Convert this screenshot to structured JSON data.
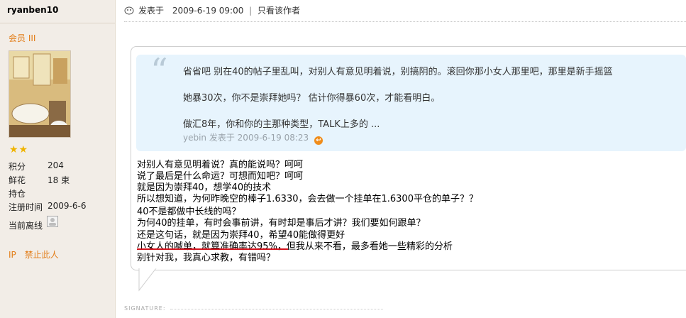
{
  "user": {
    "name": "ryanben10",
    "rank": "会员 III",
    "stats": [
      {
        "label": "积分",
        "value": "204"
      },
      {
        "label": "鲜花",
        "value": "18 束"
      },
      {
        "label": "持仓",
        "value": ""
      },
      {
        "label": "注册时间",
        "value": "2009-6-6"
      }
    ],
    "online_label": "当前离线",
    "stars": "★★",
    "actions": [
      "IP",
      "禁止此人"
    ]
  },
  "post": {
    "posted_label": "发表于",
    "posted_time": "2009-6-19 09:00",
    "separator": "|",
    "author_only": "只看该作者"
  },
  "quote": {
    "lines": [
      "省省吧  别在40的帖子里乱叫，对别人有意见明着说，别搞阴的。滚回你那小女人那里吧，那里是新手摇篮",
      "她暴30次，你不是崇拜她吗？  估计你得暴60次，才能看明白。",
      "做汇8年，你和你的主那种类型，TALK上多的   ..."
    ],
    "meta": "yebin 发表于  2009-6-19 08:23"
  },
  "body": {
    "lines": [
      "对别人有意见明着说？真的能说吗？呵呵",
      "说了最后是什么命运？可想而知吧？呵呵",
      "就是因为崇拜40，想学40的技术",
      "所以想知道，为何昨晚空的棒子1.6330，会去做一个挂单在1.6300平仓的单子？？",
      "40不是都做中长线的吗？",
      "为何40的挂单，有时会事前讲，有时却是事后才讲？我们要如何跟单？",
      "还是这句话，就是因为崇拜40，希望40能做得更好",
      "小女人的喊单，就算准确率达95%，但我从来不看，最多看她一些精彩的分析",
      "别针对我，我真心求教，有错吗？"
    ]
  },
  "signature": "SIGNATURE:",
  "colors": {
    "accent_orange": "#e27d18",
    "quote_bg": "#e7f4fd",
    "sidebar_bg": "#f2ede7",
    "underline_red": "#d3121c"
  },
  "icons": {
    "post_icon": "post-bubble-icon",
    "online_icon": "offline-status-icon",
    "quote_link_icon": "goto-quote-icon"
  }
}
